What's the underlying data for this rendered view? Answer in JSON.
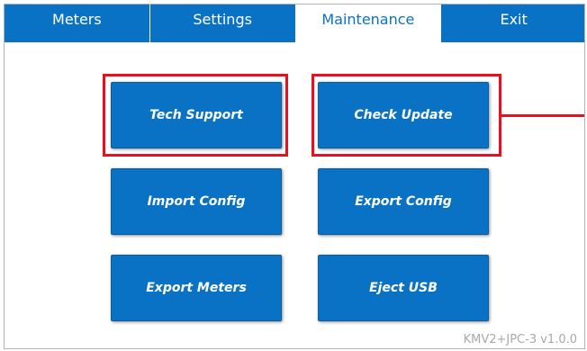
{
  "tabs": [
    {
      "label": "Meters"
    },
    {
      "label": "Settings"
    },
    {
      "label": "Maintenance"
    },
    {
      "label": "Exit"
    }
  ],
  "active_tab": "Maintenance",
  "buttons": {
    "tech_support": "Tech Support",
    "check_update": "Check Update",
    "import_config": "Import Config",
    "export_config": "Export Config",
    "export_meters": "Export Meters",
    "eject_usb": "Eject USB"
  },
  "version": "KMV2+JPC-3  v1.0.0",
  "colors": {
    "accent": "#0a72c4",
    "highlight": "#e8101e",
    "version_text": "#a8a8a8"
  }
}
